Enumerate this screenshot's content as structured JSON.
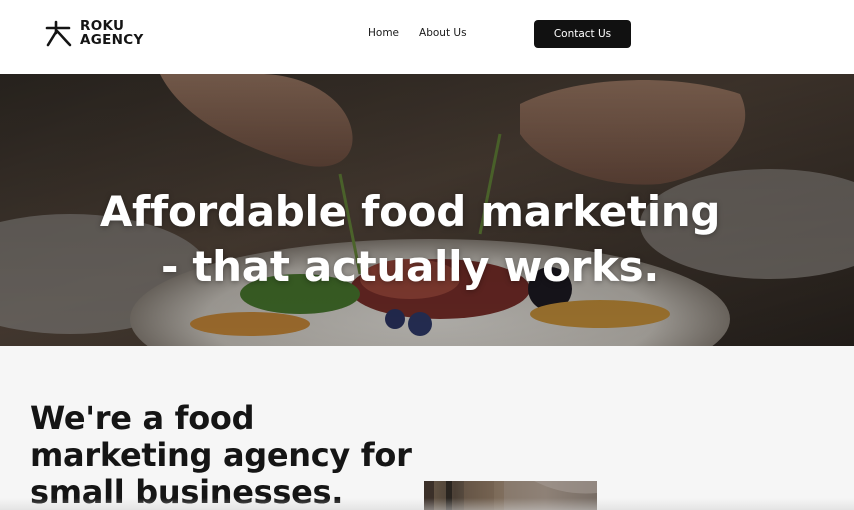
{
  "brand": {
    "name_line1": "ROKU",
    "name_line2": "AGENCY",
    "logo_icon": "stick-figure-icon"
  },
  "nav": {
    "items": [
      {
        "label": "Home"
      },
      {
        "label": "About Us"
      }
    ],
    "cta_label": "Contact Us"
  },
  "hero": {
    "headline_line1": "Affordable food marketing",
    "headline_line2": "- that actually works.",
    "background_image": "chef-plating-food-photo"
  },
  "intro": {
    "heading_line1": "We're a food",
    "heading_line2": "marketing agency for",
    "heading_line3": "small businesses.",
    "image": "restaurant-interior-photo"
  },
  "colors": {
    "cta_background": "#111111",
    "cta_text": "#ffffff",
    "section_background": "#f6f6f6",
    "text_primary": "#151515"
  }
}
